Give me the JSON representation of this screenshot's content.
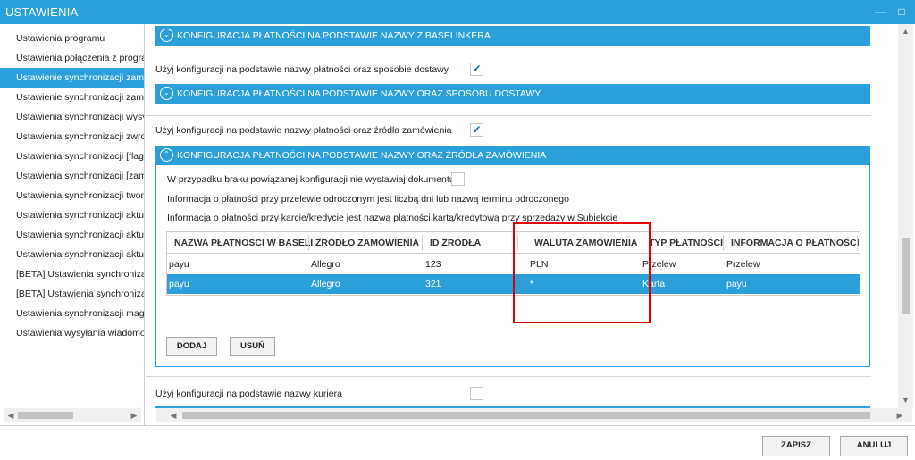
{
  "window": {
    "title": "USTAWIENIA",
    "minimize_glyph": "—",
    "maximize_glyph": "□"
  },
  "sidebar": {
    "items": [
      {
        "label": "Ustawienia programu"
      },
      {
        "label": "Ustawienia połączenia z programem Subiekt"
      },
      {
        "label": "Ustawienie synchronizacji zamówień"
      },
      {
        "label": "Ustawienie synchronizacji zamówień"
      },
      {
        "label": "Ustawienia synchronizacji wysyłek"
      },
      {
        "label": "Ustawienia synchronizacji zwrotów"
      },
      {
        "label": "Ustawienia synchronizacji [flagi]"
      },
      {
        "label": "Ustawienia synchronizacji [zamówienia]"
      },
      {
        "label": "Ustawienia synchronizacji tworzenia"
      },
      {
        "label": "Ustawienia synchronizacji aktualizacji"
      },
      {
        "label": "Ustawienia synchronizacji aktualizacji"
      },
      {
        "label": "Ustawienia synchronizacji aktualizacji"
      },
      {
        "label": "[BETA] Ustawienia synchronizacji"
      },
      {
        "label": "[BETA] Ustawienia synchronizacji"
      },
      {
        "label": "Ustawienia synchronizacji magazynów"
      },
      {
        "label": "Ustawienia wysyłania wiadomości"
      }
    ]
  },
  "main": {
    "band1": {
      "title": "KONFIGURACJA PŁATNOŚCI NA PODSTAWIE NAZWY Z BASELINKERA"
    },
    "opt1": {
      "label": "Użyj konfiguracji na podstawie nazwy płatności oraz sposobie dostawy",
      "checked": "✔"
    },
    "band2": {
      "title": "KONFIGURACJA PŁATNOŚCI NA PODSTAWIE NAZWY ORAZ SPOSOBU DOSTAWY"
    },
    "opt2": {
      "label": "Użyj konfiguracji na podstawie nazwy płatności oraz źródła zamówienia",
      "checked": "✔"
    },
    "band3": {
      "title": "KONFIGURACJA PŁATNOŚCI NA PODSTAWIE NAZWY ORAZ ŹRÓDŁA ZAMÓWIENIA"
    },
    "panel": {
      "no_doc_label": "W przypadku braku powiązanej konfiguracji nie wystawiaj dokumentu",
      "info1": "Informacja o płatności przy przelewie odroczonym jest liczbą dni lub nazwą terminu odroczonego",
      "info2": "Informacja o płatności przy karcie/kredycie jest nazwą płatności kartą/kredytową przy sprzedaży w Subiekcie",
      "columns": [
        "NAZWA PŁATNOŚCI W BASELI",
        "ŹRÓDŁO ZAMÓWIENIA",
        "ID ŹRÓDŁA",
        "WALUTA ZAMÓWIENIA",
        "TYP PŁATNOŚCI",
        "INFORMACJA O PŁATNOŚCI"
      ],
      "rows": [
        [
          "payu",
          "Allegro",
          "123",
          "PLN",
          "Przelew",
          "Przelew"
        ],
        [
          "payu",
          "Allegro",
          "321",
          "*",
          "Karta",
          "payu"
        ]
      ],
      "add_label": "DODAJ",
      "remove_label": "USUŃ"
    },
    "opt3": {
      "label": "Użyj konfiguracji na podstawie nazwy kuriera",
      "checked": ""
    }
  },
  "footer": {
    "save_label": "ZAPISZ",
    "cancel_label": "ANULUJ"
  },
  "colors": {
    "accent": "#2b9fd9",
    "highlight_box": "#e00000"
  }
}
